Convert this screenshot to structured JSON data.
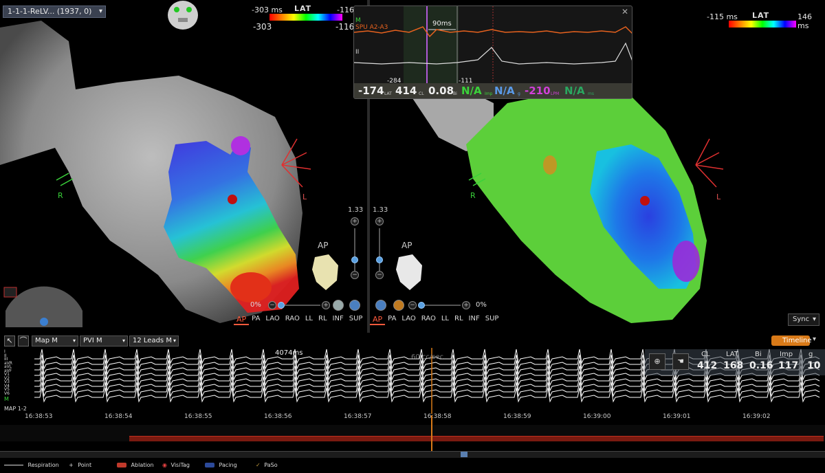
{
  "left_map": {
    "title": "1-1-1-ReLV... (1937, 0)",
    "lat": {
      "label": "LAT",
      "min_top": "-303 ms",
      "max_top": "-116",
      "min": "-303",
      "max": "-116"
    },
    "orient_l": "L",
    "orient_r": "R",
    "zoom": "1.33",
    "view_heading": "AP",
    "pct": "0%",
    "views": [
      "AP",
      "PA",
      "LAO",
      "RAO",
      "LL",
      "RL",
      "INF",
      "SUP"
    ]
  },
  "right_map": {
    "lat": {
      "label": "LAT",
      "min": "-115 ms",
      "max": "146 ms"
    },
    "orient_l": "L",
    "orient_r": "R",
    "zoom": "1.33",
    "view_heading": "AP",
    "pct": "0%",
    "views": [
      "AP",
      "PA",
      "LAO",
      "RAO",
      "LL",
      "RL",
      "INF",
      "SUP"
    ],
    "sync": "Sync"
  },
  "popup": {
    "close": "✕",
    "ch_m": "M",
    "ch_spu": "SPU A2-A3",
    "ch_ii": "II",
    "interval": "90ms",
    "marker_left": "-284",
    "marker_right": "-111",
    "readout": {
      "lat": "-174",
      "lat_unit": "LAT",
      "cl": "414",
      "cl_unit": "CL",
      "bi": "0.08",
      "bi_unit": "Bi",
      "imp": "N/A",
      "imp_unit": "Imp",
      "g": "N/A",
      "g_unit": "g",
      "lpm": "-210",
      "lpm_unit": "LPM",
      "last": "N/A",
      "last_unit": "ms"
    }
  },
  "bottom": {
    "selects": [
      "Map M",
      "PVI M",
      "12 Leads M"
    ],
    "timeline": "Timeline",
    "interval_label": "4074ms",
    "rate_label": "60 cc/sec",
    "lead_m": "M",
    "lead_map": "MAP 1-2",
    "leads": [
      "I",
      "II",
      "III",
      "aVR",
      "aVL",
      "aVF",
      "V1",
      "V2",
      "V3",
      "V4",
      "V5",
      "V6"
    ],
    "readout": {
      "headers": [
        "CL",
        "LAT",
        "Bi",
        "Imp",
        "g"
      ],
      "values": [
        "412",
        "168",
        "0.16",
        "117",
        "10"
      ]
    },
    "times": [
      "16:38:53",
      "16:38:54",
      "16:38:55",
      "16:38:56",
      "16:38:57",
      "16:38:58",
      "16:38:59",
      "16:39:00",
      "16:39:01",
      "16:39:02"
    ],
    "legend": [
      "Respiration",
      "Point",
      "Ablation",
      "VisiTag",
      "Pacing",
      "PaSo"
    ]
  },
  "colors": {
    "accent_orange": "#d97a18",
    "ablation": "#c0392b",
    "pacing": "#2c4a9a",
    "ecg": "#ffffff",
    "spu": "#e8621e"
  }
}
